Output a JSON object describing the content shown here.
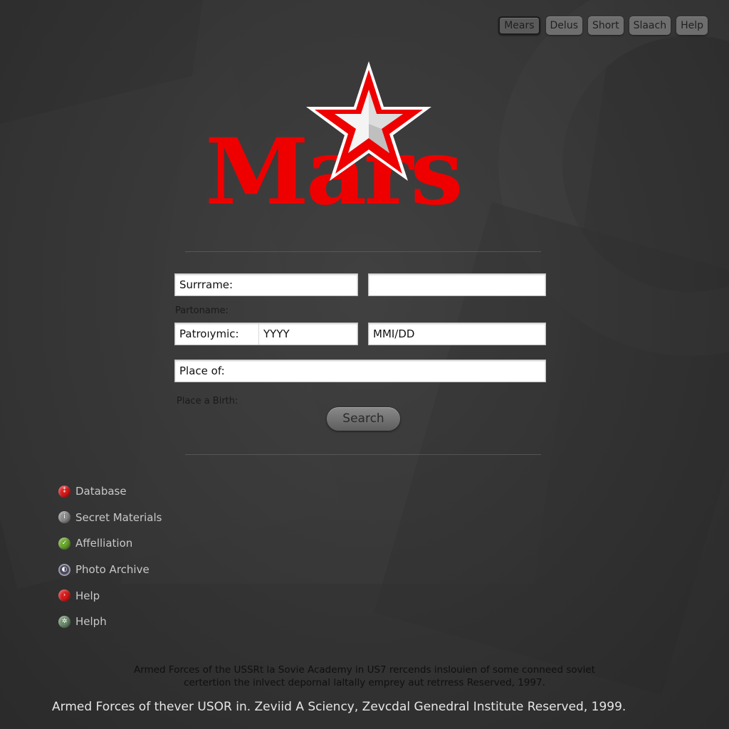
{
  "topnav": {
    "items": [
      {
        "label": "Mears",
        "active": true
      },
      {
        "label": "Delus",
        "active": false
      },
      {
        "label": "Short",
        "active": false
      },
      {
        "label": "Slaach",
        "active": false
      },
      {
        "label": "Help",
        "active": false
      }
    ]
  },
  "logo": {
    "wordmark": "Mars",
    "star_icon": "red-star-icon",
    "colors": {
      "red": "#ee0000",
      "white": "#ffffff"
    }
  },
  "form": {
    "surname_field": {
      "placeholder": "Surrrame:",
      "value": ""
    },
    "second_field": {
      "placeholder": "",
      "value": ""
    },
    "partoname_label": "Partoname:",
    "patronymic_field": {
      "placeholder": "Patroıymic:",
      "value": ""
    },
    "year_field": {
      "placeholder": "YYYY",
      "value": ""
    },
    "date_field": {
      "placeholder": "MMI/DD",
      "value": ""
    },
    "place_field": {
      "placeholder": "Place of:",
      "value": ""
    },
    "place_birth_label": "Place a Birth:",
    "search_button": "Search"
  },
  "sidebar": {
    "items": [
      {
        "label": "Database",
        "icon": "red-dot-icon",
        "color": "#d61a1a",
        "glyph": "⁑"
      },
      {
        "label": "Secret Materials",
        "icon": "info-icon",
        "color": "#8a8a8a",
        "glyph": "i"
      },
      {
        "label": "Affelliation",
        "icon": "check-icon",
        "color": "#6aa52c",
        "glyph": "✓"
      },
      {
        "label": "Photo Archive",
        "icon": "photo-icon",
        "color": "#4a4a5c",
        "glyph": "◐"
      },
      {
        "label": "Help",
        "icon": "help-red-icon",
        "color": "#d61a1a",
        "glyph": "›"
      },
      {
        "label": "Helph",
        "icon": "help-green-icon",
        "color": "#6b8a6b",
        "glyph": "✲"
      }
    ]
  },
  "footer": {
    "line1": "Armed Forces of the USSRt la Sovie Academy in US7 rercends inslouien of some conneed soviet",
    "line2": "certertion the inlvect depornal laltally emprey aut retrress Reserved, 1997.",
    "line3": "Armed Forces of thever USOR in. Zeviid A Sciency, Zevcdal Genedral Institute Reserved, 1999."
  }
}
